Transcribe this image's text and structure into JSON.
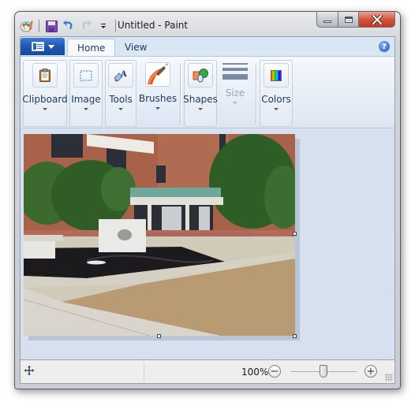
{
  "window": {
    "title": "Untitled - Paint",
    "caption_buttons": {
      "minimize": "minimize-icon",
      "maximize": "maximize-icon",
      "close": "close-icon"
    }
  },
  "quick_access": [
    {
      "name": "paint-app-icon"
    },
    {
      "name": "save-icon"
    },
    {
      "name": "undo-icon"
    },
    {
      "name": "redo-icon"
    },
    {
      "name": "customize-qat-icon"
    }
  ],
  "tabs": [
    {
      "label": "Home",
      "active": true
    },
    {
      "label": "View",
      "active": false
    }
  ],
  "help_label": "?",
  "ribbon": {
    "groups": [
      {
        "label": "Clipboard",
        "icon": "clipboard-icon",
        "enabled": true
      },
      {
        "label": "Image",
        "icon": "select-icon",
        "enabled": true
      },
      {
        "label": "Tools",
        "icon": "tools-icon",
        "enabled": true
      },
      {
        "label": "Brushes",
        "icon": "brush-icon",
        "enabled": true
      },
      {
        "label": "Shapes",
        "icon": "shapes-icon",
        "enabled": true
      },
      {
        "label": "Size",
        "icon": "size-icon",
        "enabled": false
      },
      {
        "label": "Colors",
        "icon": "colors-icon",
        "enabled": true
      }
    ]
  },
  "canvas": {
    "content": "photo of building courtyard with fountain and sculpture"
  },
  "status": {
    "cursor_icon": "move-cursor-icon",
    "zoom_percent": "100%",
    "zoom_out_label": "−",
    "zoom_in_label": "+",
    "zoom_slider_value": 0.5
  },
  "colors": {
    "accent_blue": "#1e58b0",
    "close_red": "#d2553e",
    "canvas_bg": "#d6e0ee"
  }
}
